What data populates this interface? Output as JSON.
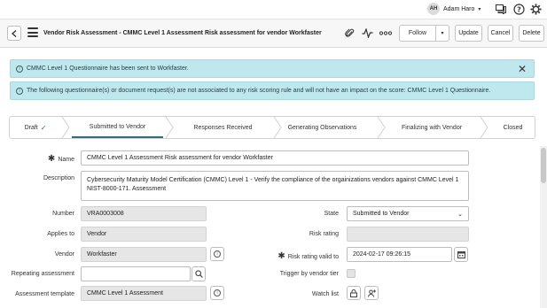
{
  "topbar": {
    "user_initials": "AH",
    "user_name": "Adam Haro",
    "icons": [
      "chat-icon",
      "help-icon",
      "gear-icon"
    ]
  },
  "header": {
    "title_bold": "Vendor Risk Assessment - CMMC Level 1 Assessment Risk assessment for vendor Workfaster",
    "follow_label": "Follow",
    "update_label": "Update",
    "cancel_label": "Cancel",
    "delete_label": "Delete",
    "icons": [
      "attachment-icon",
      "activity-icon",
      "more-icon"
    ]
  },
  "alerts": [
    {
      "text": "CMMC Level 1 Questionnaire has been sent to Workfaster."
    },
    {
      "text": "The following questionnaire(s) or document request(s) are not associated to any risk scoring rule and will not have an impact on the score: CMMC Level 1 Questionnaire."
    }
  ],
  "stages": [
    {
      "label": "Draft",
      "state": "done"
    },
    {
      "label": "Submitted to Vendor",
      "state": "active"
    },
    {
      "label": "Responses Received",
      "state": "pending"
    },
    {
      "label": "Generating Observations",
      "state": "pending"
    },
    {
      "label": "Finalizing with Vendor",
      "state": "pending"
    },
    {
      "label": "Closed",
      "state": "pending"
    }
  ],
  "form": {
    "name_label": "Name",
    "name_value": "CMMC Level 1 Assessment Risk assessment for vendor Workfaster",
    "description_label": "Description",
    "description_value": "Cybersecurity Maturity Model Certification (CMMC) Level 1 - Verify the compliance of the orgainizations vendors against CMMC Level 1 NIST-8000-171. Assessment",
    "number_label": "Number",
    "number_value": "VRA0003008",
    "state_label": "State",
    "state_value": "Submitted to Vendor",
    "applies_to_label": "Applies to",
    "applies_to_value": "Vendor",
    "risk_rating_label": "Risk rating",
    "risk_rating_value": "",
    "vendor_label": "Vendor",
    "vendor_value": "Workfaster",
    "risk_rating_valid_label": "Risk rating valid to",
    "risk_rating_valid_value": "2024-02-17 09:26:15",
    "repeating_label": "Repeating assessment",
    "repeating_value": "",
    "trigger_label": "Trigger by vendor tier",
    "template_label": "Assessment template",
    "template_value": "CMMC Level 1 Assessment",
    "watch_label": "Watch list"
  }
}
